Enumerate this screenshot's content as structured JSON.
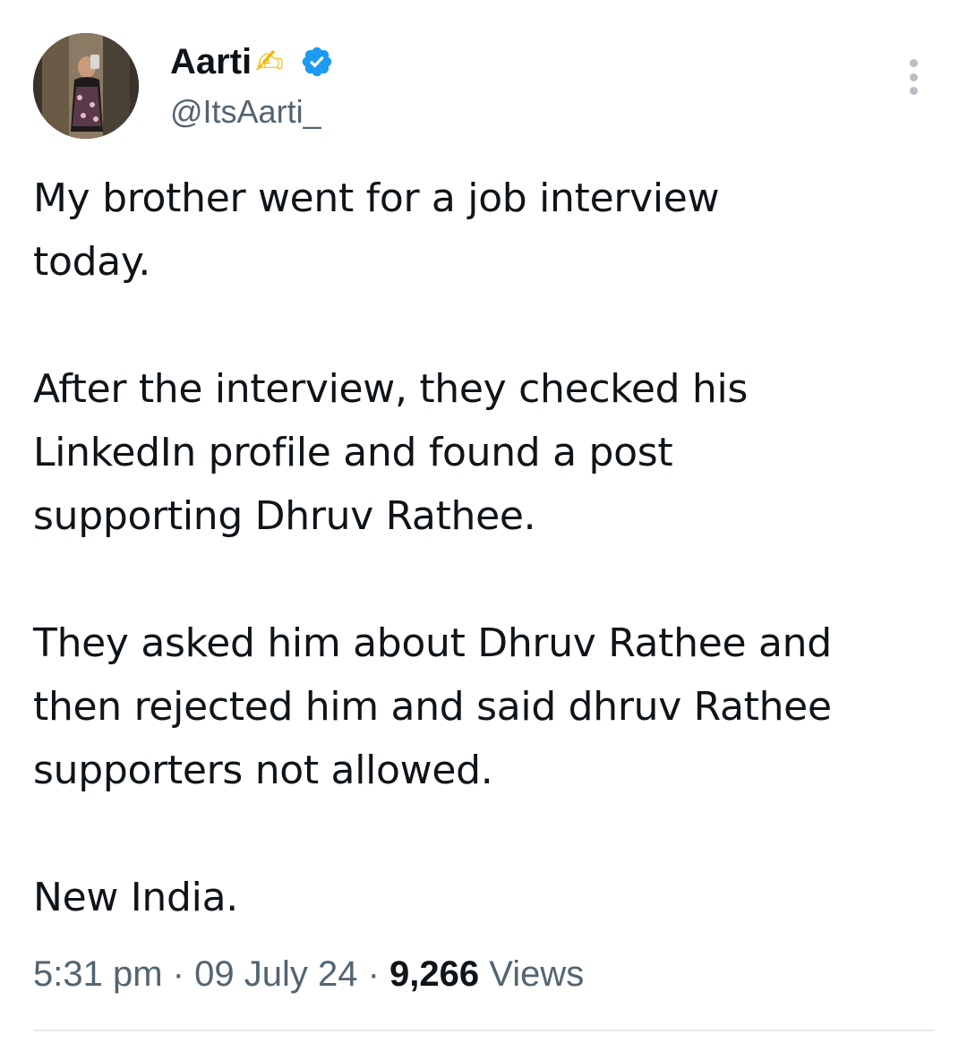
{
  "author": {
    "display_name": "Aarti",
    "emoji": "✍",
    "verified": true,
    "handle": "@ItsAarti_"
  },
  "tweet": {
    "paragraphs": [
      [
        "My brother went for a job interview",
        "today."
      ],
      [
        "After the interview, they checked his",
        "LinkedIn profile and found a post",
        "supporting Dhruv Rathee."
      ],
      [
        "They asked him about Dhruv Rathee and",
        "then rejected him and said dhruv Rathee",
        "supporters not allowed."
      ],
      [
        "New India."
      ]
    ]
  },
  "meta": {
    "time": "5:31 pm",
    "separator": "·",
    "date": "09 July 24",
    "views_count": "9,266",
    "views_label": "Views"
  },
  "colors": {
    "text": "#0f1419",
    "secondary": "#536471",
    "verified_blue": "#1d9bf0"
  },
  "icons": {
    "verified": "verified-badge-icon",
    "more": "more-vertical-icon"
  }
}
